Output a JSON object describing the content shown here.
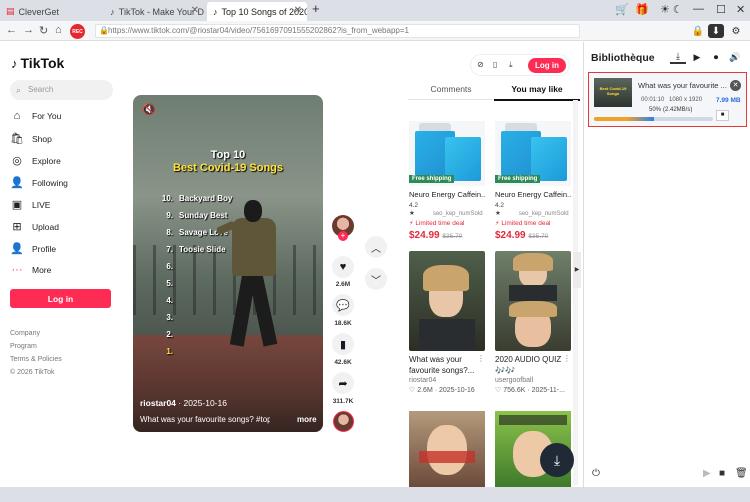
{
  "browser": {
    "tabs": [
      {
        "label": "CleverGet"
      },
      {
        "label": "TikTok - Make Your D"
      },
      {
        "label": "Top 10 Songs of 2020"
      }
    ],
    "rec_label": "REC",
    "url": "https://www.tiktok.com/@riostar04/video/7561697091555202862?is_from_webapp=1"
  },
  "tiktok": {
    "logo": "TikTok",
    "search_placeholder": "Search",
    "nav": [
      {
        "label": "For You",
        "icon": "home-icon"
      },
      {
        "label": "Shop",
        "icon": "bag-icon"
      },
      {
        "label": "Explore",
        "icon": "compass-icon"
      },
      {
        "label": "Following",
        "icon": "user-plus-icon"
      },
      {
        "label": "LIVE",
        "icon": "live-icon"
      },
      {
        "label": "Upload",
        "icon": "plus-square-icon"
      },
      {
        "label": "Profile",
        "icon": "user-icon"
      },
      {
        "label": "More",
        "icon": "more-icon"
      }
    ],
    "login": "Log in",
    "footer": [
      "Company",
      "Program",
      "Terms & Policies",
      "© 2026 TikTok"
    ]
  },
  "video": {
    "title1": "Top 10",
    "title2": "Best Covid-19 Songs",
    "ranks": [
      {
        "n": "10.",
        "song": "Backyard Boy"
      },
      {
        "n": "9.",
        "song": "Sunday Best"
      },
      {
        "n": "8.",
        "song": "Savage Love"
      },
      {
        "n": "7.",
        "song": "Toosie Slide"
      },
      {
        "n": "6.",
        "song": ""
      },
      {
        "n": "5.",
        "song": ""
      },
      {
        "n": "4.",
        "song": ""
      },
      {
        "n": "3.",
        "song": ""
      },
      {
        "n": "2.",
        "song": ""
      },
      {
        "n": "1.",
        "song": ""
      }
    ],
    "author": "riostar04",
    "date": " · 2025-10-16",
    "description": "What was your favourite songs? #top10 ...",
    "more": "more"
  },
  "actions": {
    "likes": "2.6M",
    "comments": "18.6K",
    "saves": "42.6K",
    "shares": "311.7K"
  },
  "right": {
    "login": "Log in",
    "tabs": [
      "Comments",
      "You may like"
    ],
    "products": [
      {
        "badge": "Free shipping",
        "name": "Neuro Energy Caffein...",
        "rating": "4.2 ★",
        "seller": "seo_kep_numSold",
        "limited": "⚡ Limited time deal",
        "price": "$24.99",
        "old_price": "$35.70"
      },
      {
        "badge": "Free shipping",
        "name": "Neuro Energy Caffein...",
        "rating": "4.2 ★",
        "seller": "seo_kep_numSold",
        "limited": "⚡ Limited time deal",
        "price": "$24.99",
        "old_price": "$35.70"
      }
    ],
    "videos": [
      {
        "title": "What was your favourite songs?...",
        "author": "riostar04",
        "stats": "♡ 2.6M · 2025-10-16"
      },
      {
        "title": "2020 AUDIO QUIZ 🎶🎶",
        "author": "usergoofball",
        "stats": "♡ 756.6K · 2025-11-..."
      }
    ]
  },
  "panel": {
    "title": "Bibliothèque",
    "item": {
      "title": "What was your favourite ...",
      "duration": "00:01:10",
      "resolution": "1080 x 1920",
      "size": "7.99 MB",
      "percent": "50%",
      "speed": "(2.42MB/s)",
      "progress": 0.5
    }
  },
  "colors": {
    "brand": "#fe2c55",
    "price": "#e12a3c",
    "highlight_border": "#e53935",
    "size_text": "#2c6bd8"
  }
}
